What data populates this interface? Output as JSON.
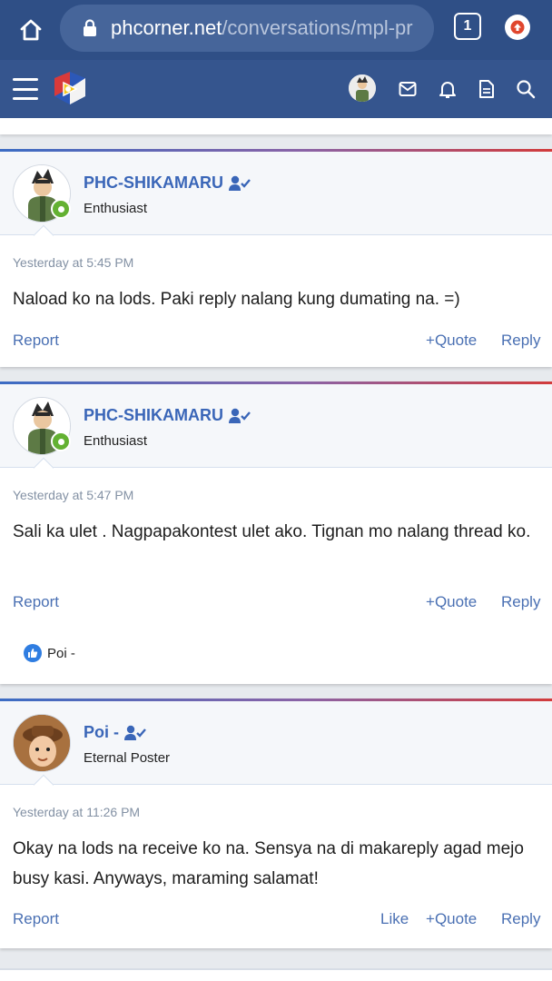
{
  "browser": {
    "url_host": "phcorner.net",
    "url_path": "/conversations/mpl-pr",
    "tab_count": "1",
    "icons": [
      "home-icon",
      "lock-icon",
      "tabs-icon",
      "upload-icon"
    ]
  },
  "header": {
    "icons": [
      "menu-icon",
      "site-logo",
      "user-avatar",
      "mail-icon",
      "bell-icon",
      "document-icon",
      "search-icon"
    ]
  },
  "messages": [
    {
      "username": "PHC-SHIKAMARU",
      "user_title": "Enthusiast",
      "time": "Yesterday at 5:45 PM",
      "body": "Naload ko na lods. Paki reply nalang kung dumating na. =)",
      "report": "Report",
      "quote": "Quote",
      "reply": "Reply",
      "online": true
    },
    {
      "username": "PHC-SHIKAMARU",
      "user_title": "Enthusiast",
      "time": "Yesterday at 5:47 PM",
      "body": "Sali ka ulet . Nagpapakontest ulet ako. Tignan mo nalang thread ko.",
      "report": "Report",
      "quote": "Quote",
      "reply": "Reply",
      "reaction_user": "Poi -",
      "online": true
    },
    {
      "username": "Poi -",
      "user_title": "Eternal Poster",
      "time": "Yesterday at 11:26 PM",
      "body": "Okay na lods na receive ko na. Sensya na di makareply agad mejo busy kasi. Anyways, maraming salamat!",
      "report": "Report",
      "like": "Like",
      "quote": "Quote",
      "reply": "Reply",
      "online": false
    }
  ],
  "colors": {
    "browser_bar": "#2f4f86",
    "site_header": "#35558e",
    "link": "#4a70b3",
    "username": "#3a66b8",
    "online": "#63b132"
  }
}
